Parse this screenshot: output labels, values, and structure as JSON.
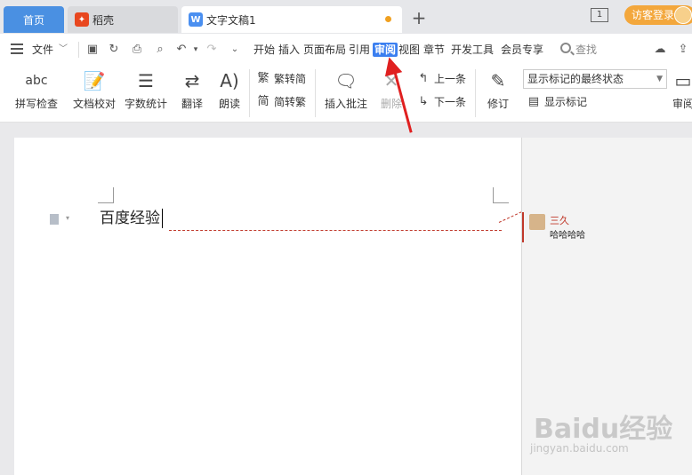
{
  "tabs": {
    "home": "首页",
    "daoke": "稻壳",
    "doc": "文字文稿1",
    "new_tab_symbol": "+"
  },
  "topbar": {
    "page_indicator": "1",
    "visitor_login": "访客登录"
  },
  "menubar": {
    "file": "文件",
    "file_caret": "﹀",
    "items": [
      "开始",
      "插入",
      "页面布局",
      "引用",
      "审阅",
      "视图",
      "章节",
      "开发工具",
      "会员专享"
    ],
    "active": "审阅",
    "search": "查找"
  },
  "ribbon": {
    "spell_icon": "abc",
    "spell": "拼写检查",
    "proofread": "文档校对",
    "word_count": "字数统计",
    "translate": "翻译",
    "read_aloud": "朗读",
    "trad": "繁转简",
    "simp": "简转繁",
    "insert_comment": "插入批注",
    "delete": "删除",
    "prev": "上一条",
    "next": "下一条",
    "revise": "修订",
    "markup_state": "显示标记的最终状态",
    "show_markup": "显示标记",
    "review_partial": "审阅"
  },
  "document": {
    "text": "百度经验"
  },
  "comment": {
    "author": "三久",
    "body": "哈哈哈哈"
  },
  "watermark": {
    "main": "Baidu经验",
    "sub": "jingyan.baidu.com"
  }
}
